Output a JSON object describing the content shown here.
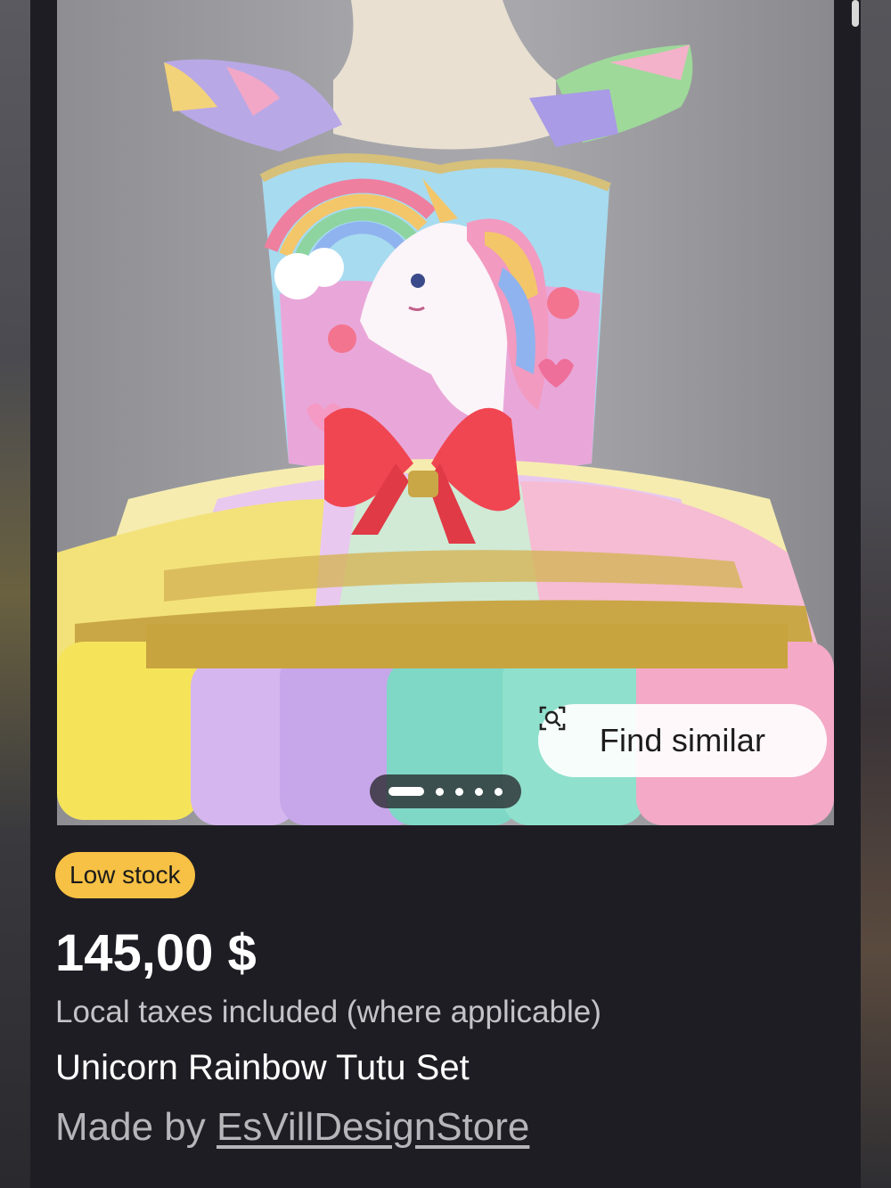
{
  "listing": {
    "image": {
      "alt_subject": "unicorn rainbow tutu dress on mannequin",
      "find_similar_label": "Find similar",
      "find_similar_icon": "visual-search-icon",
      "carousel": {
        "total_images": 5,
        "active_index": 0
      }
    },
    "stock_badge": "Low stock",
    "price": "145,00 $",
    "tax_note": "Local taxes included (where applicable)",
    "title": "Unicorn Rainbow Tutu Set",
    "maker_prefix": "Made by",
    "shop_name": "EsVillDesignStore"
  },
  "colors": {
    "panel_bg": "#1e1d24",
    "badge_bg": "#f6c144",
    "text_primary": "#ffffff",
    "text_secondary": "#c4c4c8"
  }
}
